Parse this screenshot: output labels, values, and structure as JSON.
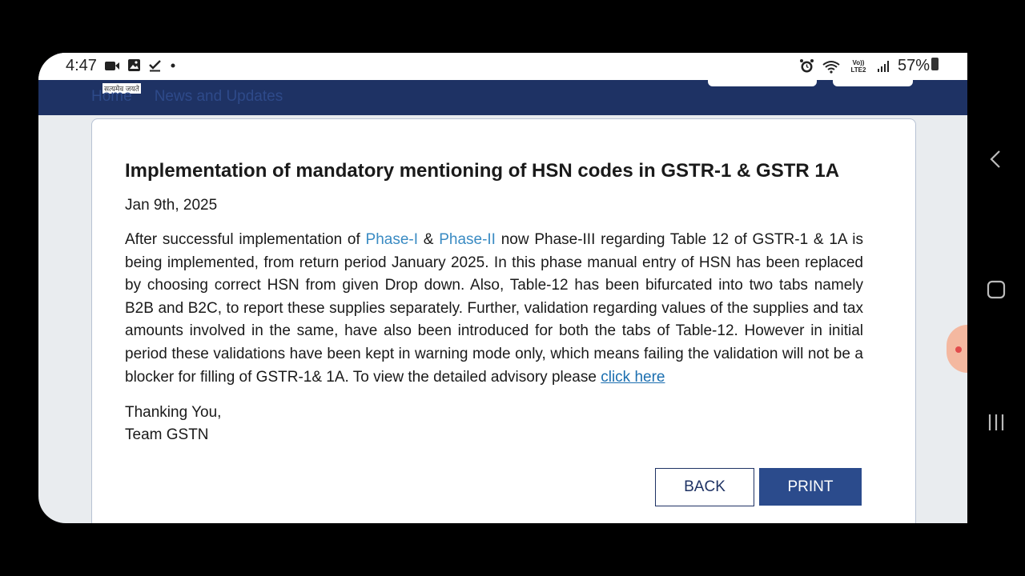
{
  "status_bar": {
    "time": "4:47",
    "left_icons": [
      "video-icon",
      "image-icon",
      "check-icon",
      "dot-icon"
    ],
    "right_icons": [
      "alarm-icon",
      "wifi-icon",
      "volte-icon",
      "signal-icon"
    ],
    "volte_label": "Vo)) LTE2",
    "battery": "57%"
  },
  "site_header": {
    "motto": "सत्यमेव जयते",
    "breadcrumb": {
      "home": "Home",
      "current": "News and Updates"
    },
    "color": "#1e3264"
  },
  "article": {
    "title": "Implementation of mandatory mentioning of HSN codes in GSTR-1 & GSTR 1A",
    "date": "Jan 9th, 2025",
    "intro": "After successful implementation of ",
    "phase1": "Phase-I",
    "amp": " & ",
    "phase2": "Phase-II",
    "body": " now Phase-III regarding Table 12 of GSTR-1 & 1A is being implemented, from return period January 2025. In this phase manual entry of HSN has been replaced by choosing correct HSN from given Drop down. Also, Table-12 has been bifurcated into two tabs namely B2B and B2C, to report these supplies separately. Further, validation regarding values of the supplies and tax amounts involved in the same, have also been introduced for both the tabs of Table-12. However in initial period these validations have been kept in warning mode only, which means failing the validation will not be a blocker for filling of GSTR-1& 1A. To view the detailed advisory please ",
    "link": "click here",
    "sign_line1": "Thanking You,",
    "sign_line2": "Team GSTN"
  },
  "actions": {
    "back": "BACK",
    "print": "PRINT",
    "print_color": "#2b4b8c"
  },
  "system_nav": {
    "icons": [
      "back-chevron-icon",
      "home-square-icon",
      "recents-icon"
    ]
  }
}
